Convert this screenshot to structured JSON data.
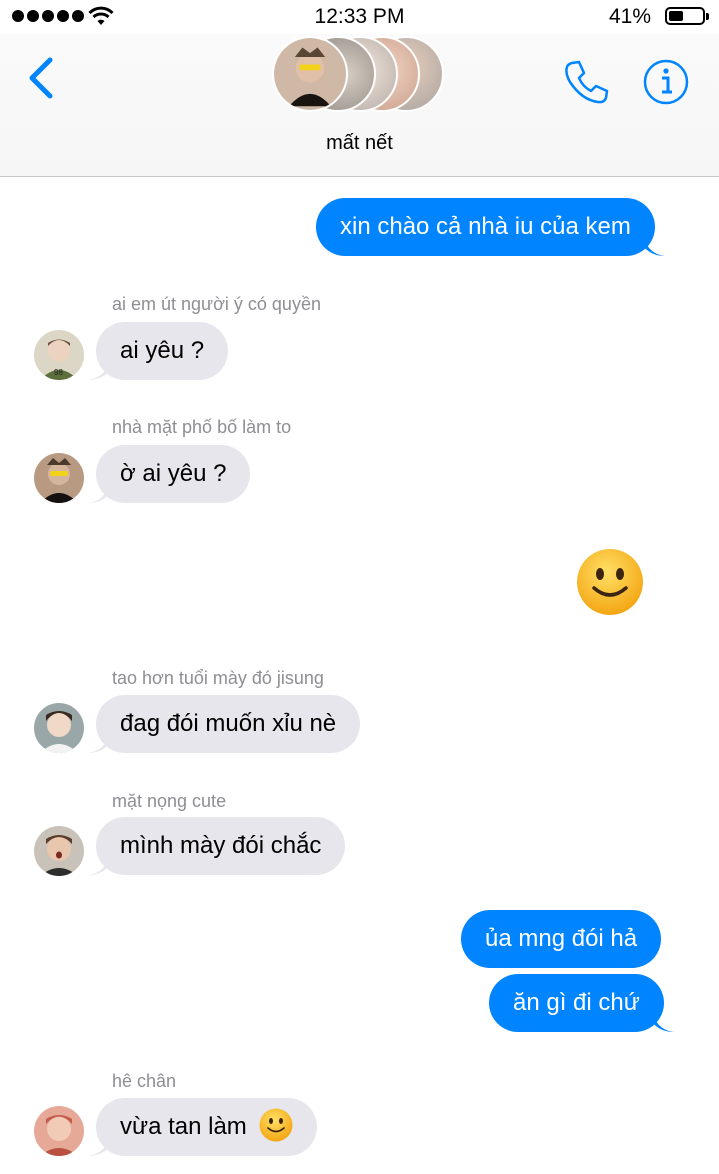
{
  "status": {
    "time": "12:33 PM",
    "battery": "41%"
  },
  "header": {
    "group_name": "mất nết"
  },
  "messages": {
    "m1": {
      "text": "xin chào cả nhà iu của kem"
    },
    "m2": {
      "sender": "ai em út người ý có quyền",
      "text": "ai yêu ?"
    },
    "m3": {
      "sender": "nhà mặt phố bố làm to",
      "text": "ờ ai yêu ?"
    },
    "m5": {
      "sender": "tao hơn tuổi mày đó jisung",
      "text": "đag đói muốn xỉu nè"
    },
    "m6": {
      "sender": "mặt nọng cute",
      "text": "mình mày đói chắc"
    },
    "m7": {
      "text": "ủa mng đói hả"
    },
    "m8": {
      "text": "ăn gì đi chứ"
    },
    "m9": {
      "sender": "hê chân",
      "text": "vừa tan làm"
    }
  },
  "colors": {
    "accent": "#0084ff",
    "incoming_bubble": "#e6e6ec",
    "sender_label": "#8e8e93"
  },
  "icons": [
    "back-chevron-icon",
    "phone-icon",
    "info-icon",
    "smile-emoji-icon"
  ]
}
